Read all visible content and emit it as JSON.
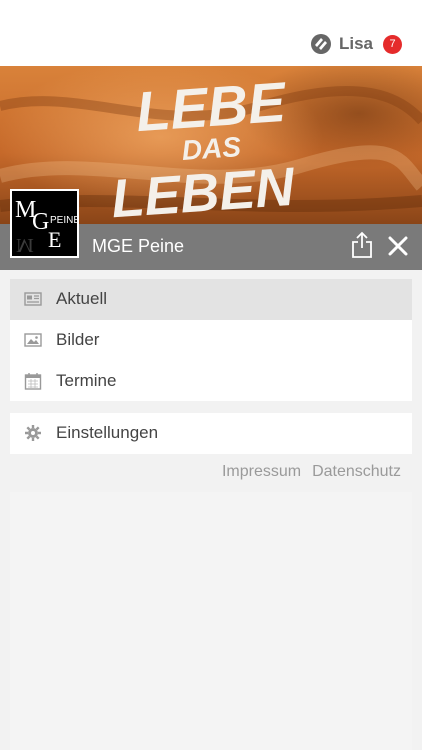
{
  "user": {
    "name": "Lisa",
    "notification_count": "7"
  },
  "app": {
    "title": "MGE Peine"
  },
  "banner": {
    "lines": [
      "LEBE",
      "DAS",
      "LEBEN"
    ]
  },
  "logo": {
    "letter_m": "M",
    "letter_g": "G",
    "letter_e": "E",
    "word": "PEINE"
  },
  "menu": [
    {
      "label": "Aktuell",
      "icon": "newspaper-icon",
      "active": true
    },
    {
      "label": "Bilder",
      "icon": "image-icon",
      "active": false
    },
    {
      "label": "Termine",
      "icon": "calendar-icon",
      "active": false
    }
  ],
  "settings": {
    "label": "Einstellungen",
    "icon": "gear-icon"
  },
  "footer_links": {
    "impressum": "Impressum",
    "datenschutz": "Datenschutz"
  },
  "colors": {
    "badge": "#e52b2b",
    "titlebar": "#7a7a7a",
    "banner": "#d9823a"
  }
}
